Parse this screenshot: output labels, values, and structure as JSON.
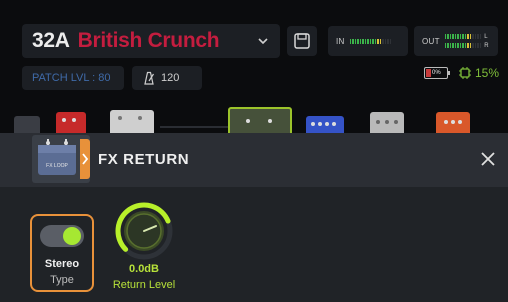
{
  "header": {
    "patch_number": "32A",
    "patch_name": "British Crunch",
    "input_meter_label": "IN",
    "output_meter_label": "OUT",
    "output_channel_left": "L",
    "output_channel_right": "R",
    "input_level": 0.75,
    "output_level": 0.75
  },
  "status": {
    "patch_level": "PATCH LVL : 80",
    "tempo": "120",
    "battery_percent": "0%",
    "cpu_percent": "15%"
  },
  "chain": {
    "blocks": [
      {
        "name": "input",
        "color": "#3a3d44"
      },
      {
        "name": "red-effect",
        "color": "#c62a2a"
      },
      {
        "name": "white-effect",
        "color": "#d9d9d9"
      },
      {
        "name": "fx-loop",
        "color": "#5b6d94",
        "selected": true
      },
      {
        "name": "blue-effect",
        "color": "#3553c7"
      },
      {
        "name": "grey-effect",
        "color": "#b9b9b9"
      },
      {
        "name": "orange-effect",
        "color": "#d9582a"
      }
    ]
  },
  "panel": {
    "title": "FX RETURN",
    "icon_label": "FX LOOP",
    "params": [
      {
        "value": "Stereo",
        "label": "Type",
        "toggle_on": true
      },
      {
        "value": "0.0dB",
        "label": "Return Level",
        "level": 0.75
      }
    ]
  },
  "colors": {
    "accent_orange": "#e8913a",
    "accent_green": "#a6e832",
    "patch_name_red": "#c41d3f",
    "patch_level_blue": "#3f6aa8"
  }
}
